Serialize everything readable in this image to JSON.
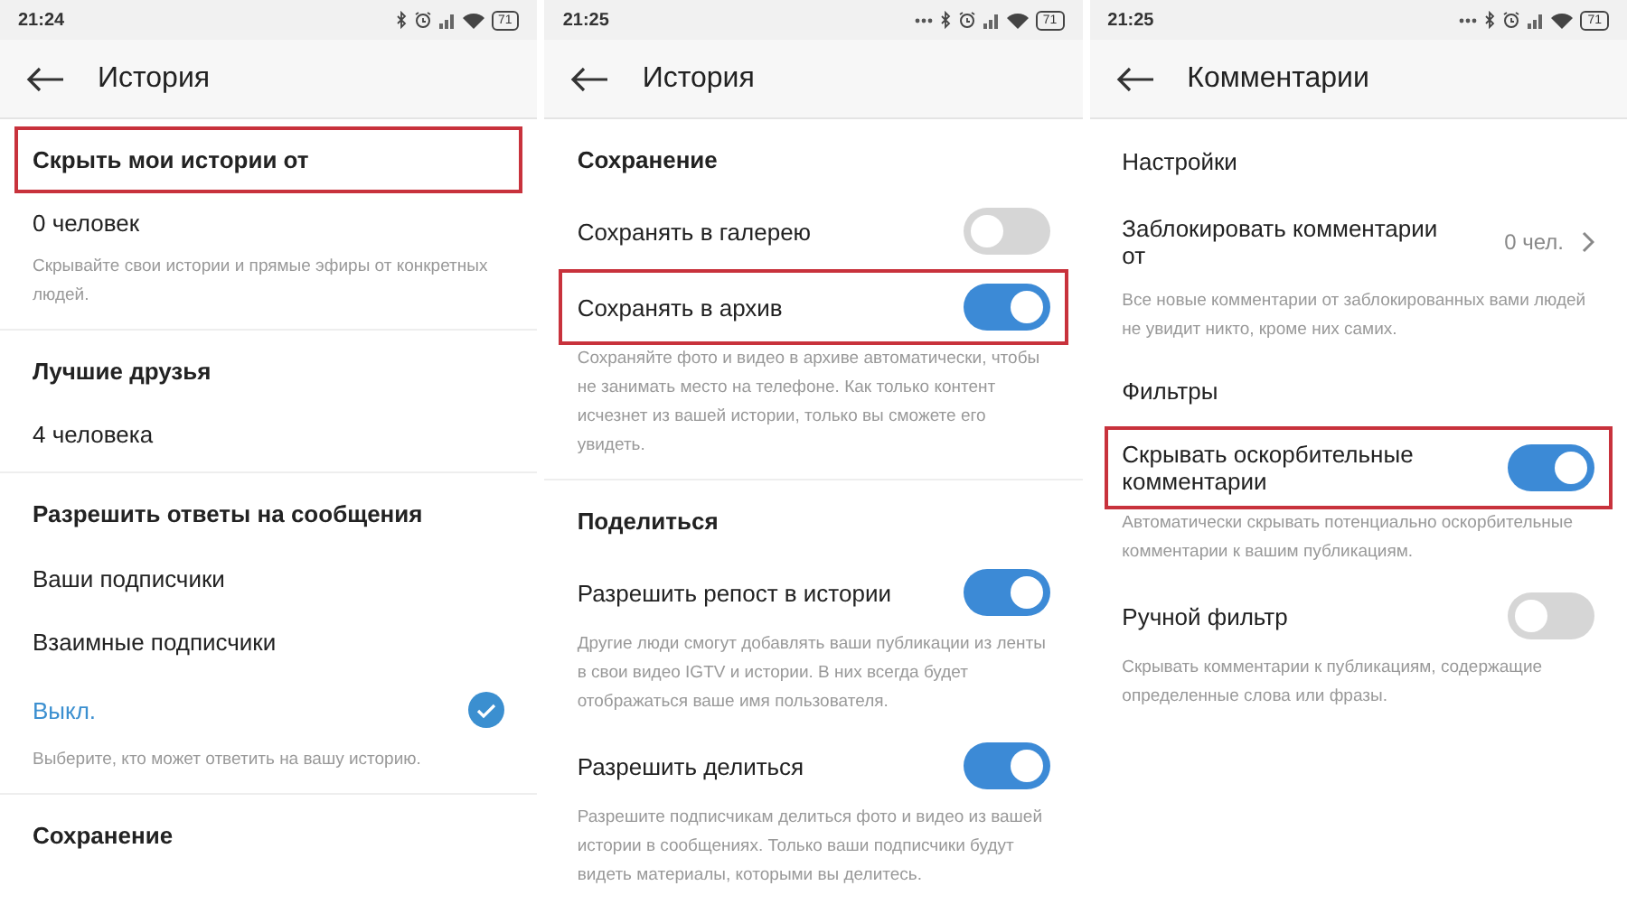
{
  "screens": [
    {
      "status_bar": {
        "time": "21:24",
        "battery": "71",
        "more_notifications": false
      },
      "title": "История",
      "items": [
        {
          "kind": "heading",
          "text": "Скрыть мои истории от",
          "highlighted": true
        },
        {
          "kind": "row",
          "text": "0 человек"
        },
        {
          "kind": "note",
          "text": "Скрывайте свои истории и прямые эфиры от конкретных людей."
        },
        {
          "kind": "divider"
        },
        {
          "kind": "heading",
          "text": "Лучшие друзья"
        },
        {
          "kind": "row",
          "text": "4 человека"
        },
        {
          "kind": "divider"
        },
        {
          "kind": "heading",
          "text": "Разрешить ответы на сообщения"
        },
        {
          "kind": "option",
          "text": "Ваши подписчики",
          "selected": false
        },
        {
          "kind": "option",
          "text": "Взаимные подписчики",
          "selected": false
        },
        {
          "kind": "option",
          "text": "Выкл.",
          "selected": true
        },
        {
          "kind": "note",
          "text": "Выберите, кто может ответить на вашу историю."
        },
        {
          "kind": "divider"
        },
        {
          "kind": "heading",
          "text": "Сохранение"
        }
      ]
    },
    {
      "status_bar": {
        "time": "21:25",
        "battery": "71",
        "more_notifications": true
      },
      "title": "История",
      "items": [
        {
          "kind": "heading",
          "text": "Сохранение"
        },
        {
          "kind": "toggle",
          "text": "Сохранять в галерею",
          "on": false
        },
        {
          "kind": "toggle",
          "text": "Сохранять в архив",
          "on": true,
          "highlighted": true
        },
        {
          "kind": "note",
          "text": "Сохраняйте фото и видео в архиве автоматически, чтобы не занимать место на телефоне. Как только контент исчезнет из вашей истории, только вы сможете его увидеть."
        },
        {
          "kind": "divider"
        },
        {
          "kind": "heading",
          "text": "Поделиться"
        },
        {
          "kind": "toggle",
          "text": "Разрешить репост в истории",
          "on": true
        },
        {
          "kind": "note",
          "text": "Другие люди смогут добавлять ваши публикации из ленты в свои видео IGTV и истории. В них всегда будет отображаться ваше имя пользователя."
        },
        {
          "kind": "toggle",
          "text": "Разрешить делиться",
          "on": true
        },
        {
          "kind": "note",
          "text": "Разрешите подписчикам делиться фото и видео из вашей истории в сообщениях. Только ваши подписчики будут видеть материалы, которыми вы делитесь."
        }
      ]
    },
    {
      "status_bar": {
        "time": "21:25",
        "battery": "71",
        "more_notifications": true
      },
      "title": "Комментарии",
      "items": [
        {
          "kind": "subheading",
          "text": "Настройки"
        },
        {
          "kind": "value-row",
          "text": "Заблокировать комментарии от",
          "value": "0 чел."
        },
        {
          "kind": "note",
          "text": "Все новые комментарии от заблокированных вами людей не увидит никто, кроме них самих."
        },
        {
          "kind": "subheading",
          "text": "Фильтры"
        },
        {
          "kind": "toggle",
          "text": "Скрывать оскорбительные комментарии",
          "on": true,
          "highlighted": true
        },
        {
          "kind": "note",
          "text": "Автоматически скрывать потенциально оскорбительные комментарии к вашим публикациям."
        },
        {
          "kind": "toggle",
          "text": "Ручной фильтр",
          "on": false
        },
        {
          "kind": "note",
          "text": "Скрывать комментарии к публикациям, содержащие определенные слова или фразы."
        }
      ]
    }
  ]
}
